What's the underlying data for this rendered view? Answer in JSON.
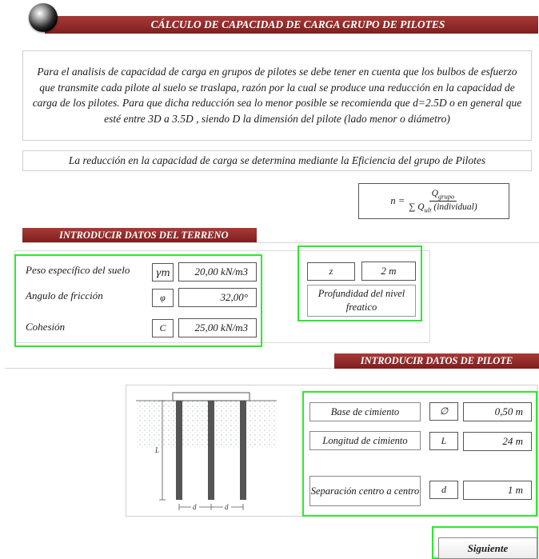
{
  "header": {
    "title": "CÁLCULO DE CAPACIDAD DE CARGA GRUPO DE PILOTES",
    "logo_icon": "sphere-logo-icon"
  },
  "intro": {
    "lines": [
      "Para el analisis de capacidad de carga en grupos de pilotes se debe tener en cuenta que los  bulbos de esfuerzo",
      "que transmite cada pilote al suelo se traslapa, razón por la cual se produce una reducción en la capacidad de",
      "carga de los pilotes. Para que dicha reducción sea lo menor posible se recomienda que d=2.5D o en general que",
      "esté entre 3D a 3.5D , siendo D la dimensión del pilote (lado menor o diámetro)"
    ]
  },
  "reduction_text": "La reducción en la capacidad de carga se determina mediante la Eficiencia del grupo de Pilotes",
  "formula": {
    "lhs": "n =",
    "numerator": "Q",
    "numerator_sub": "grupo",
    "denominator": "∑ Q",
    "denominator_sub": "ult",
    "denominator_suffix": " (individual)"
  },
  "soil": {
    "section_title": "INTRODUCIR DATOS DEL TERRENO",
    "fields": [
      {
        "label": "Peso específico del suelo",
        "symbol": "γm",
        "value": "20,00 kN/m3"
      },
      {
        "label": "Angulo de fricción",
        "symbol": "φ",
        "value": "32,00°"
      },
      {
        "label": "Cohesión",
        "symbol": "C",
        "value": "25,00 kN/m3"
      }
    ],
    "water_table": {
      "symbol": "z",
      "value": "2 m",
      "label": "Profundidad  del nivel freatico"
    }
  },
  "pile": {
    "section_title": "INTRODUCIR DATOS DE PILOTE",
    "fields": [
      {
        "label": "Base de cimiento",
        "symbol": "∅",
        "value": "0,50 m"
      },
      {
        "label": "Longitud de cimiento",
        "symbol": "L",
        "value": "24 m"
      },
      {
        "label": "Separación centro a centro",
        "symbol": "d",
        "value": "1 m"
      }
    ],
    "diagram": {
      "length_label": "L",
      "spacing_label": "d"
    }
  },
  "next_button": "Siguiente"
}
